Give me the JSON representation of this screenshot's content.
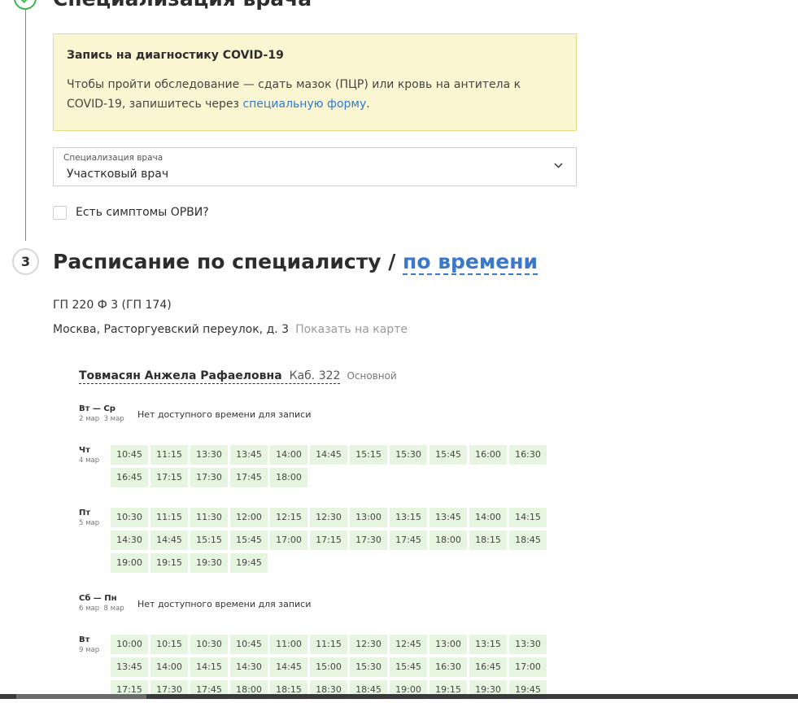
{
  "top_section": {
    "title": "Специализация врача"
  },
  "covid_notice": {
    "title": "Запись на диагностику COVID-19",
    "text_before": "Чтобы пройти обследование — сдать мазок (ПЦР) или кровь на антитела к COVID-19, запишитесь через",
    "link": "специальную форму",
    "text_after": "."
  },
  "specialization_select": {
    "label": "Специализация врача",
    "value": "Участковый врач"
  },
  "symptoms_checkbox": {
    "label": "Есть симптомы ОРВИ?",
    "checked": false
  },
  "schedule_section": {
    "step": "3",
    "title": "Расписание по специалисту /",
    "alt_link": "по времени"
  },
  "clinic": {
    "name": "ГП 220 Ф 3 (ГП 174)",
    "address": "Москва, Расторгуевский переулок, д. 3",
    "map_link": "Показать на карте"
  },
  "doctor": {
    "name": "Товмасян Анжела Рафаеловна",
    "room": "Каб. 322",
    "tag": "Основной"
  },
  "no_slots_text": "Нет доступного времени для записи",
  "days": [
    {
      "name": "Вт — Ср",
      "date_from": "2 мар",
      "date_to": "3 мар",
      "slots": []
    },
    {
      "name": "Чт",
      "date": "4 мар",
      "slots": [
        "10:45",
        "11:15",
        "13:30",
        "13:45",
        "14:00",
        "14:45",
        "15:15",
        "15:30",
        "15:45",
        "16:00",
        "16:30",
        "16:45",
        "17:15",
        "17:30",
        "17:45",
        "18:00"
      ]
    },
    {
      "name": "Пт",
      "date": "5 мар",
      "slots": [
        "10:30",
        "11:15",
        "11:30",
        "12:00",
        "12:15",
        "12:30",
        "13:00",
        "13:15",
        "13:45",
        "14:00",
        "14:15",
        "14:30",
        "14:45",
        "15:15",
        "15:45",
        "17:00",
        "17:15",
        "17:30",
        "17:45",
        "18:00",
        "18:15",
        "18:45",
        "19:00",
        "19:15",
        "19:30",
        "19:45"
      ]
    },
    {
      "name": "Сб — Пн",
      "date_from": "6 мар",
      "date_to": "8 мар",
      "slots": []
    },
    {
      "name": "Вт",
      "date": "9 мар",
      "slots": [
        "10:00",
        "10:15",
        "10:30",
        "10:45",
        "11:00",
        "11:15",
        "12:30",
        "12:45",
        "13:00",
        "13:15",
        "13:30",
        "13:45",
        "14:00",
        "14:15",
        "14:30",
        "14:45",
        "15:00",
        "15:30",
        "15:45",
        "16:30",
        "16:45",
        "17:00",
        "17:15",
        "17:30",
        "17:45",
        "18:00",
        "18:15",
        "18:30",
        "18:45",
        "19:00",
        "19:15",
        "19:30",
        "19:45"
      ]
    }
  ],
  "colors": {
    "accent_green": "#3bb44a",
    "link_blue": "#2e7ad1",
    "slot_bg": "#e6f5df",
    "notice_bg": "#fbf6d2"
  }
}
